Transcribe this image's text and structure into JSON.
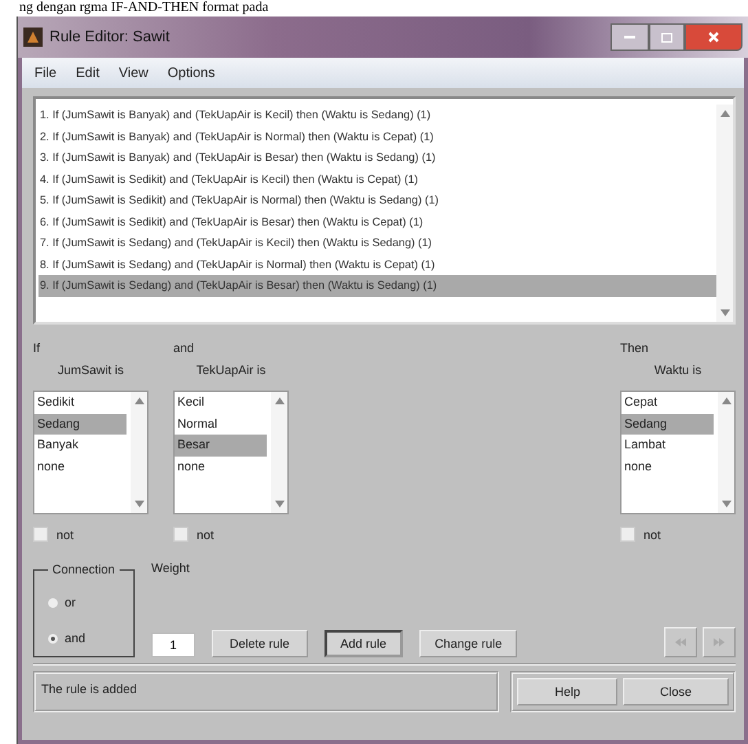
{
  "document_text": "ng dengan rgma IF-AND-THEN format pada",
  "window": {
    "title": "Rule Editor: Sawit"
  },
  "menu": [
    {
      "label": "File"
    },
    {
      "label": "Edit"
    },
    {
      "label": "View"
    },
    {
      "label": "Options"
    }
  ],
  "rules": [
    {
      "text": "1. If (JumSawit is Banyak) and (TekUapAir is Kecil) then (Waktu is Sedang) (1)",
      "selected": false
    },
    {
      "text": "2. If (JumSawit is Banyak) and (TekUapAir is Normal) then (Waktu is Cepat) (1)",
      "selected": false
    },
    {
      "text": "3. If (JumSawit is Banyak) and (TekUapAir is Besar) then (Waktu is Sedang) (1)",
      "selected": false
    },
    {
      "text": "4. If (JumSawit is Sedikit) and (TekUapAir is Kecil) then (Waktu is Cepat) (1)",
      "selected": false
    },
    {
      "text": "5. If (JumSawit is Sedikit) and (TekUapAir is Normal) then (Waktu is Sedang) (1)",
      "selected": false
    },
    {
      "text": "6. If (JumSawit is Sedikit) and (TekUapAir is Besar) then (Waktu is Cepat) (1)",
      "selected": false
    },
    {
      "text": "7. If (JumSawit is Sedang) and (TekUapAir is Kecil) then (Waktu is Sedang) (1)",
      "selected": false
    },
    {
      "text": "8. If (JumSawit is Sedang) and (TekUapAir is Normal) then (Waktu is Cepat) (1)",
      "selected": false
    },
    {
      "text": "9. If (JumSawit is Sedang) and (TekUapAir is Besar) then (Waktu is Sedang) (1)",
      "selected": true
    }
  ],
  "columns": [
    {
      "heading": "If",
      "label": "JumSawit is",
      "options": [
        {
          "label": "Sedikit",
          "selected": false
        },
        {
          "label": "Sedang",
          "selected": true
        },
        {
          "label": "Banyak",
          "selected": false
        },
        {
          "label": "none",
          "selected": false
        }
      ],
      "not": {
        "label": "not",
        "checked": false
      }
    },
    {
      "heading": "and",
      "label": "TekUapAir is",
      "options": [
        {
          "label": "Kecil",
          "selected": false
        },
        {
          "label": "Normal",
          "selected": false
        },
        {
          "label": "Besar",
          "selected": true
        },
        {
          "label": "none",
          "selected": false
        }
      ],
      "not": {
        "label": "not",
        "checked": false
      }
    },
    {
      "heading": "Then",
      "label": "Waktu is",
      "options": [
        {
          "label": "Cepat",
          "selected": false
        },
        {
          "label": "Sedang",
          "selected": true
        },
        {
          "label": "Lambat",
          "selected": false
        },
        {
          "label": "none",
          "selected": false
        }
      ],
      "not": {
        "label": "not",
        "checked": false
      }
    }
  ],
  "connection": {
    "title": "Connection",
    "options": [
      {
        "label": "or",
        "selected": false
      },
      {
        "label": "and",
        "selected": true
      }
    ]
  },
  "weight": {
    "label": "Weight",
    "value": "1"
  },
  "actions": [
    {
      "label": "Delete rule",
      "pressed": false
    },
    {
      "label": "Add rule",
      "pressed": true
    },
    {
      "label": "Change rule",
      "pressed": false
    }
  ],
  "status": "The rule is added",
  "footer_buttons": [
    {
      "label": "Help"
    },
    {
      "label": "Close"
    }
  ]
}
